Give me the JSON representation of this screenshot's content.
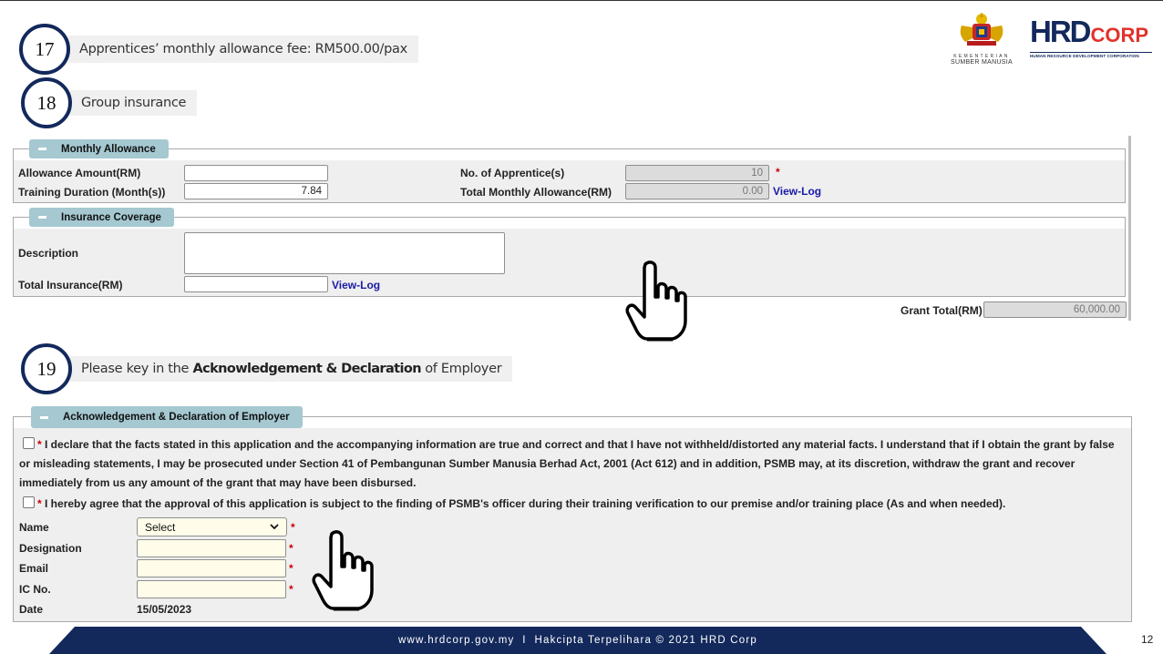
{
  "steps": [
    {
      "number": "17",
      "text": "Apprentices’ monthly allowance fee: RM500.00/pax"
    },
    {
      "number": "18",
      "text": "Group insurance"
    },
    {
      "number": "19",
      "prefix": "Please key in the ",
      "bold": "Acknowledgement & Declaration",
      "suffix": " of Employer"
    }
  ],
  "logos": {
    "kementerian": {
      "line1": "KEMENTERIAN",
      "line2": "SUMBER MANUSIA"
    },
    "hrd": {
      "main": "HRD",
      "corp": "CORP",
      "sub": "HUMAN RESOURCE DEVELOPMENT CORPORATION"
    }
  },
  "monthly_allowance": {
    "legend": "Monthly Allowance",
    "allowance_amount_label": "Allowance Amount(RM)",
    "allowance_amount_value": "",
    "training_duration_label": "Training Duration (Month(s))",
    "training_duration_value": "7.84",
    "no_apprentices_label": "No. of Apprentice(s)",
    "no_apprentices_value": "10",
    "required_mark": "*",
    "total_monthly_label": "Total Monthly Allowance(RM)",
    "total_monthly_value": "0.00",
    "view_log": "View-Log"
  },
  "insurance": {
    "legend": "Insurance Coverage",
    "description_label": "Description",
    "description_value": "",
    "total_label": "Total Insurance(RM)",
    "total_value": "",
    "view_log": "View-Log"
  },
  "grant_total": {
    "label": "Grant Total(RM)",
    "value": "60,000.00"
  },
  "acknowledgement": {
    "legend": "Acknowledgement & Declaration of Employer",
    "required_mark": "*",
    "declaration1": "I declare that the facts stated in this application and the accompanying information are true and correct and that I have not withheld/distorted any material facts. I understand that if I obtain the grant by false or misleading statements, I may be prosecuted under Section 41 of Pembangunan Sumber Manusia Berhad Act, 2001 (Act 612) and in addition, PSMB may, at its discretion, withdraw the grant and recover immediately from us any amount of the grant that may have been disbursed.",
    "declaration2": "I hereby agree that the approval of this application is subject to the finding of PSMB's officer during their training verification to our premise and/or training place (As and when needed).",
    "name_label": "Name",
    "name_value": "Select",
    "designation_label": "Designation",
    "email_label": "Email",
    "ic_label": "IC No.",
    "date_label": "Date",
    "date_value": "15/05/2023"
  },
  "footer": {
    "text": "www.hrdcorp.gov.my  I  Hakcipta Terpelihara © 2021 HRD Corp",
    "page_number": "12"
  }
}
